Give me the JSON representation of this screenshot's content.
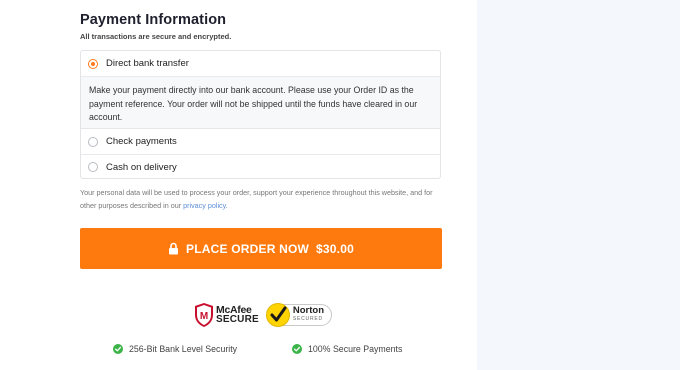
{
  "payment": {
    "title": "Payment Information",
    "subtitle": "All transactions are secure and encrypted.",
    "methods": [
      {
        "label": "Direct bank transfer",
        "selected": true
      },
      {
        "label": "Check payments",
        "selected": false
      },
      {
        "label": "Cash on delivery",
        "selected": false
      }
    ],
    "bank_description": "Make your payment directly into our bank account. Please use your Order ID as the payment reference. Your order will not be shipped until the funds have cleared in our account."
  },
  "privacy": {
    "text": "Your personal data will be used to process your order, support your experience throughout this website, and for other purposes described in our",
    "link": "privacy policy",
    "end": "."
  },
  "order_button": {
    "label": "PLACE ORDER NOW",
    "price": "$30.00",
    "icon": "lock-icon"
  },
  "badges": {
    "mcafee_name": "McAfee",
    "mcafee_secure": "SECURE",
    "norton_name": "Norton",
    "norton_secured": "SECURED"
  },
  "features": [
    {
      "label": "256-Bit Bank Level Security",
      "icon": "check-circle-icon"
    },
    {
      "label": "100% Secure Payments",
      "icon": "check-circle-icon"
    }
  ],
  "colors": {
    "accent": "#ff7a0e",
    "check_green": "#3cb44a",
    "link": "#5b8ed8",
    "right_panel": "#f4f7fb"
  }
}
